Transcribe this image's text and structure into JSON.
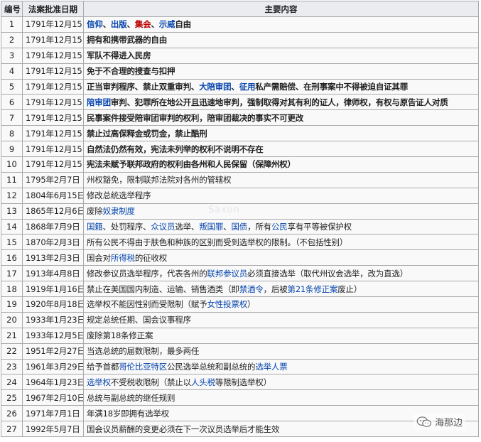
{
  "table": {
    "headers": [
      "编号",
      "法案批准日期",
      "主要内容"
    ],
    "rows": [
      {
        "num": "1",
        "date": "1791年12月15日",
        "bold": true,
        "content": [
          {
            "t": "信仰",
            "s": "link"
          },
          {
            "t": "、"
          },
          {
            "t": "出版",
            "s": "link"
          },
          {
            "t": "、"
          },
          {
            "t": "集会",
            "s": "red"
          },
          {
            "t": "、"
          },
          {
            "t": "示威",
            "s": "link"
          },
          {
            "t": "自由"
          }
        ]
      },
      {
        "num": "2",
        "date": "1791年12月15日",
        "bold": true,
        "content": [
          {
            "t": "拥有和携带武器的自由"
          }
        ]
      },
      {
        "num": "3",
        "date": "1791年12月15日",
        "bold": true,
        "content": [
          {
            "t": "军队不得进入民房"
          }
        ]
      },
      {
        "num": "4",
        "date": "1791年12月15日",
        "bold": true,
        "content": [
          {
            "t": "免于不合理的搜查与扣押"
          }
        ]
      },
      {
        "num": "5",
        "date": "1791年12月15日",
        "bold": true,
        "content": [
          {
            "t": "正当审判程序、禁止双重审判、"
          },
          {
            "t": "大陪审团",
            "s": "link"
          },
          {
            "t": "、"
          },
          {
            "t": "征用",
            "s": "link"
          },
          {
            "t": "私产需赔偿、在刑事案中不得被迫自证其罪"
          }
        ]
      },
      {
        "num": "6",
        "date": "1791年12月15日",
        "bold": true,
        "content": [
          {
            "t": "陪审团",
            "s": "link"
          },
          {
            "t": "审判、犯罪所在地公开且迅速地审判，强制取得对其有利的证人，律师权，有权与原告证人对质"
          }
        ]
      },
      {
        "num": "7",
        "date": "1791年12月15日",
        "bold": true,
        "content": [
          {
            "t": "民事案件接受陪审团审判的权利，陪审团裁决的事实不可更改"
          }
        ]
      },
      {
        "num": "8",
        "date": "1791年12月15日",
        "bold": true,
        "content": [
          {
            "t": "禁止过高保释金或罚金，禁止酷刑"
          }
        ]
      },
      {
        "num": "9",
        "date": "1791年12月15日",
        "bold": true,
        "content": [
          {
            "t": "自然法仍然有效，宪法未列举的权利不说明不存在"
          }
        ]
      },
      {
        "num": "10",
        "date": "1791年12月15日",
        "bold": true,
        "content": [
          {
            "t": "宪法未赋予联邦政府的权利由各州和人民保留（保障州权）"
          }
        ]
      },
      {
        "num": "11",
        "date": "1795年2月7日",
        "bold": false,
        "content": [
          {
            "t": "州权豁免，限制联邦法院对各州的管辖权"
          }
        ]
      },
      {
        "num": "12",
        "date": "1804年6月15日",
        "bold": false,
        "content": [
          {
            "t": "修改总统选举程序"
          }
        ]
      },
      {
        "num": "13",
        "date": "1865年12月6日",
        "bold": false,
        "content": [
          {
            "t": "废除"
          },
          {
            "t": "奴隶制度",
            "s": "link"
          }
        ]
      },
      {
        "num": "14",
        "date": "1868年7月9日",
        "bold": false,
        "content": [
          {
            "t": "国籍",
            "s": "link"
          },
          {
            "t": "、处罚程序、"
          },
          {
            "t": "众议员",
            "s": "link"
          },
          {
            "t": "选举、"
          },
          {
            "t": "叛国罪",
            "s": "link"
          },
          {
            "t": "、"
          },
          {
            "t": "国债",
            "s": "link"
          },
          {
            "t": "，所有"
          },
          {
            "t": "公民",
            "s": "link"
          },
          {
            "t": "享有平等被保护权"
          }
        ]
      },
      {
        "num": "15",
        "date": "1870年2月3日",
        "bold": false,
        "content": [
          {
            "t": "所有公民不得由于肤色和种族的区别而受到选举权的限制。（不包括性别）"
          }
        ]
      },
      {
        "num": "16",
        "date": "1913年2月3日",
        "bold": false,
        "content": [
          {
            "t": "国会对"
          },
          {
            "t": "所得税",
            "s": "link"
          },
          {
            "t": "的征收权"
          }
        ]
      },
      {
        "num": "17",
        "date": "1913年4月8日",
        "bold": false,
        "content": [
          {
            "t": "修改参议员选举程序，代表各州的"
          },
          {
            "t": "联邦参议员",
            "s": "link"
          },
          {
            "t": "必须直接选举（取代州议会选举，改为直选）"
          }
        ]
      },
      {
        "num": "18",
        "date": "1919年1月16日",
        "bold": false,
        "content": [
          {
            "t": "禁止在美国国内制造、运输、销售酒类（即"
          },
          {
            "t": "禁酒令",
            "s": "link"
          },
          {
            "t": "，后被"
          },
          {
            "t": "第21条修正案",
            "s": "link"
          },
          {
            "t": "废止）"
          }
        ]
      },
      {
        "num": "19",
        "date": "1920年8月18日",
        "bold": false,
        "content": [
          {
            "t": "选举权不能因性别而受限制（赋予"
          },
          {
            "t": "女性投票权",
            "s": "link"
          },
          {
            "t": "）"
          }
        ]
      },
      {
        "num": "20",
        "date": "1933年1月23日",
        "bold": false,
        "content": [
          {
            "t": "规定总统任期、国会议事程序"
          }
        ]
      },
      {
        "num": "21",
        "date": "1933年12月5日",
        "bold": false,
        "content": [
          {
            "t": "废除第18条修正案"
          }
        ]
      },
      {
        "num": "22",
        "date": "1951年2月27日",
        "bold": false,
        "content": [
          {
            "t": "当选总统的届数限制，最多两任"
          }
        ]
      },
      {
        "num": "23",
        "date": "1961年3月29日",
        "bold": false,
        "content": [
          {
            "t": "给予首都"
          },
          {
            "t": "哥伦比亚特区",
            "s": "link"
          },
          {
            "t": "公民选举总统和副总统的"
          },
          {
            "t": "选举人票",
            "s": "link"
          }
        ]
      },
      {
        "num": "24",
        "date": "1964年1月23日",
        "bold": false,
        "content": [
          {
            "t": "选举权",
            "s": "link"
          },
          {
            "t": "不受税收限制（禁止以"
          },
          {
            "t": "人头税",
            "s": "link"
          },
          {
            "t": "等限制选举权）"
          }
        ]
      },
      {
        "num": "25",
        "date": "1967年2月10日",
        "bold": false,
        "content": [
          {
            "t": "总统与副总统的继任规则"
          }
        ]
      },
      {
        "num": "26",
        "date": "1971年7月1日",
        "bold": false,
        "content": [
          {
            "t": "年满18岁即拥有选举权"
          }
        ]
      },
      {
        "num": "27",
        "date": "1992年5月7日",
        "bold": false,
        "content": [
          {
            "t": "国会议员薪酬的变更必须在下一次议员选举后才能生效"
          }
        ]
      }
    ]
  },
  "watermark": {
    "text": "海那边",
    "icon": "wechat-icon"
  },
  "faint_watermark": "Saxon",
  "colors": {
    "link": "#0645ad",
    "red": "#ba0000",
    "header_bg": "#eaecf0",
    "cell_bg": "#f9f9f9",
    "border": "#aaaaaa"
  }
}
